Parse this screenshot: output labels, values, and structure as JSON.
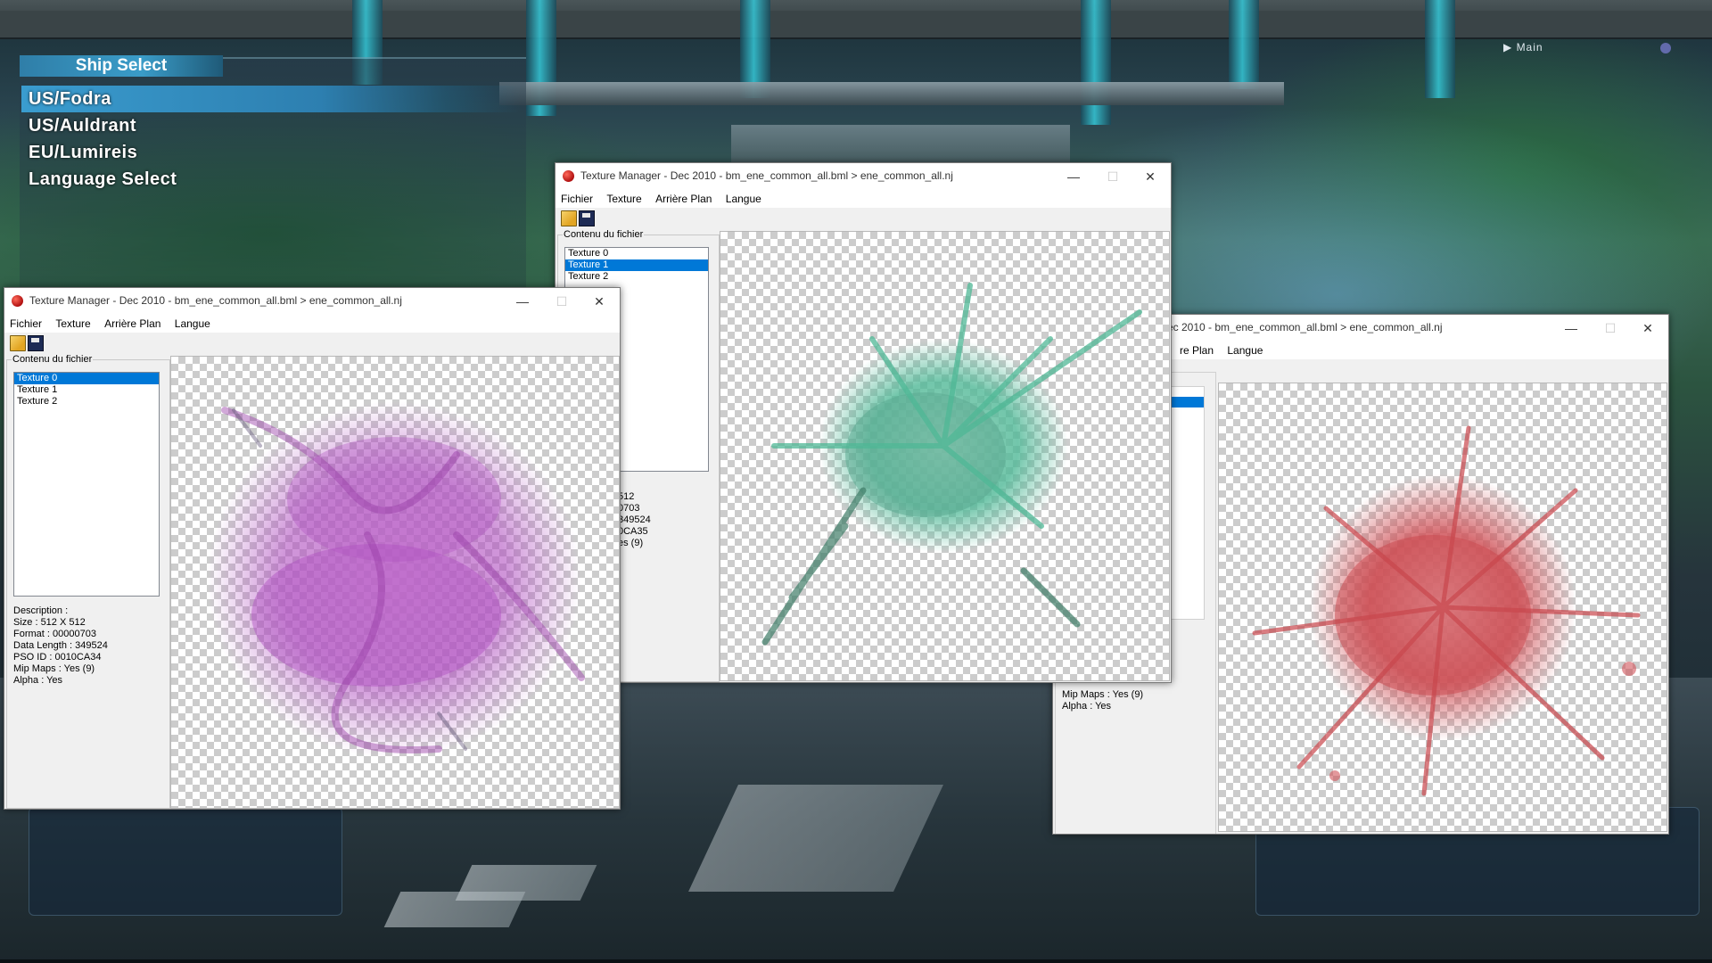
{
  "ship_select": {
    "title": "Ship Select",
    "items": [
      {
        "label": "US/Fodra",
        "selected": true
      },
      {
        "label": "US/Auldrant",
        "selected": false
      },
      {
        "label": "EU/Lumireis",
        "selected": false
      },
      {
        "label": "Language Select",
        "selected": false
      }
    ]
  },
  "hud": {
    "main_label": "▶ Main"
  },
  "window_common": {
    "title": "Texture Manager - Dec 2010 - bm_ene_common_all.bml > ene_common_all.nj",
    "minimize": "—",
    "maximize": "☐",
    "close": "✕",
    "menu": {
      "file": "Fichier",
      "texture": "Texture",
      "background": "Arrière Plan",
      "language": "Langue"
    },
    "group_label": "Contenu du fichier"
  },
  "window_left": {
    "list": [
      "Texture 0",
      "Texture 1",
      "Texture 2"
    ],
    "selected_index": 0,
    "info": [
      "Description :",
      "Size : 512 X 512",
      "Format : 00000703",
      "Data Length : 349524",
      "PSO ID : 0010CA34",
      "Mip Maps : Yes (9)",
      "Alpha : Yes"
    ],
    "splat_color": "#b04fc0"
  },
  "window_middle": {
    "list": [
      "Texture 0",
      "Texture 1",
      "Texture 2"
    ],
    "selected_index": 1,
    "info_partial": [
      "512",
      "0703",
      "349524",
      "0CA35",
      "es (9)"
    ],
    "splat_color": "#4fb896"
  },
  "window_right": {
    "title_partial": "ec 2010 - bm_ene_common_all.bml > ene_common_all.nj",
    "menu_partial": [
      "re Plan",
      "Langue"
    ],
    "info_partial": [
      "Mip Maps : Yes (9)",
      "Alpha : Yes"
    ],
    "splat_color": "#d0545a"
  }
}
